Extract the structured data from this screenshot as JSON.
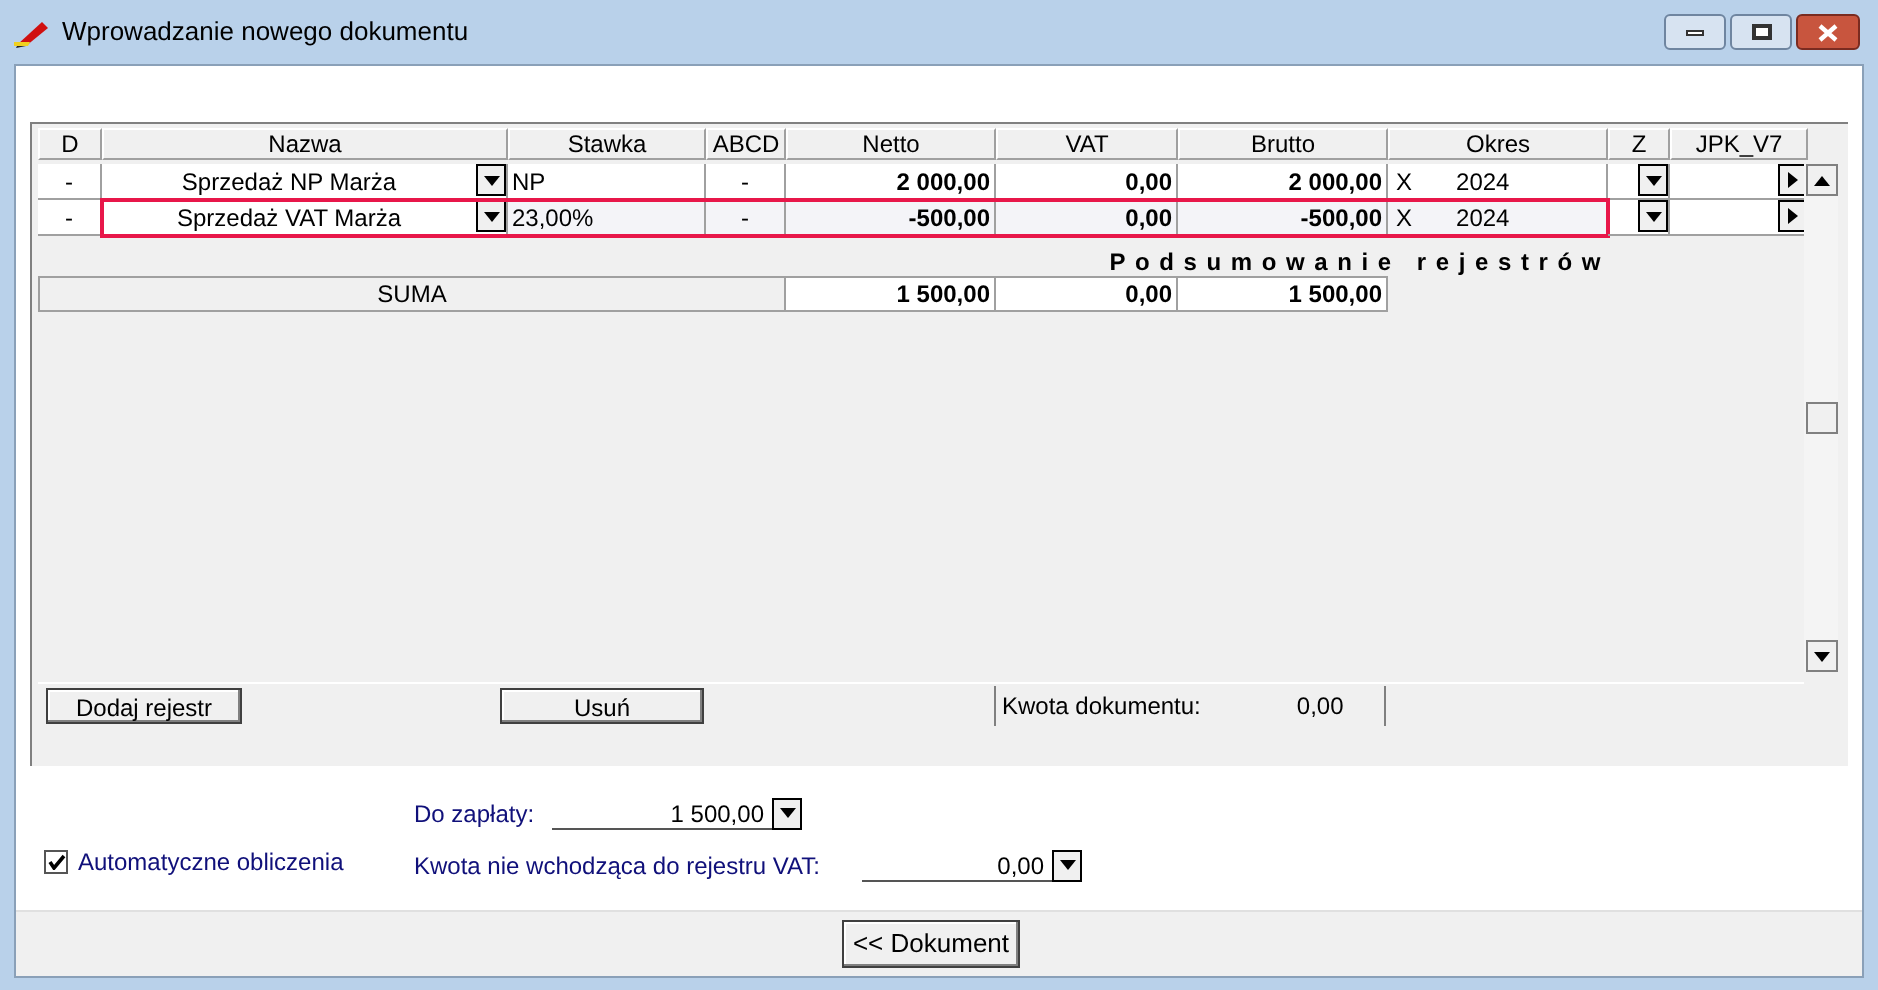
{
  "window": {
    "title": "Wprowadzanie nowego dokumentu"
  },
  "table": {
    "columns": [
      "D",
      "Nazwa",
      "Stawka",
      "ABCD",
      "Netto",
      "VAT",
      "Brutto",
      "Okres",
      "Z",
      "JPK_V7"
    ],
    "rows": [
      {
        "d": "-",
        "name": "Sprzedaż NP Marża",
        "rate": "NP",
        "abcd": "-",
        "net": "2 000,00",
        "vat": "0,00",
        "gross": "2 000,00",
        "period_mark": "X",
        "period": "2024",
        "selected": false
      },
      {
        "d": "-",
        "name": "Sprzedaż VAT Marża",
        "rate": "23,00%",
        "abcd": "-",
        "net": "-500,00",
        "vat": "0,00",
        "gross": "-500,00",
        "period_mark": "X",
        "period": "2024",
        "selected": true
      }
    ]
  },
  "summary": {
    "title": "Podsumowanie rejestrów",
    "label": "SUMA",
    "net": "1 500,00",
    "vat": "0,00",
    "gross": "1 500,00"
  },
  "actions": {
    "add": "Dodaj rejestr",
    "remove": "Usuń",
    "document_amount_label": "Kwota dokumentu:",
    "document_amount": "0,00"
  },
  "payment": {
    "label": "Do zapłaty:",
    "value": "1 500,00"
  },
  "non_vat": {
    "label": "Kwota nie wchodząca do rejestru VAT:",
    "value": "0,00"
  },
  "auto_calc": {
    "label": "Automatyczne obliczenia",
    "checked": true
  },
  "back_button": "<< Dokument"
}
